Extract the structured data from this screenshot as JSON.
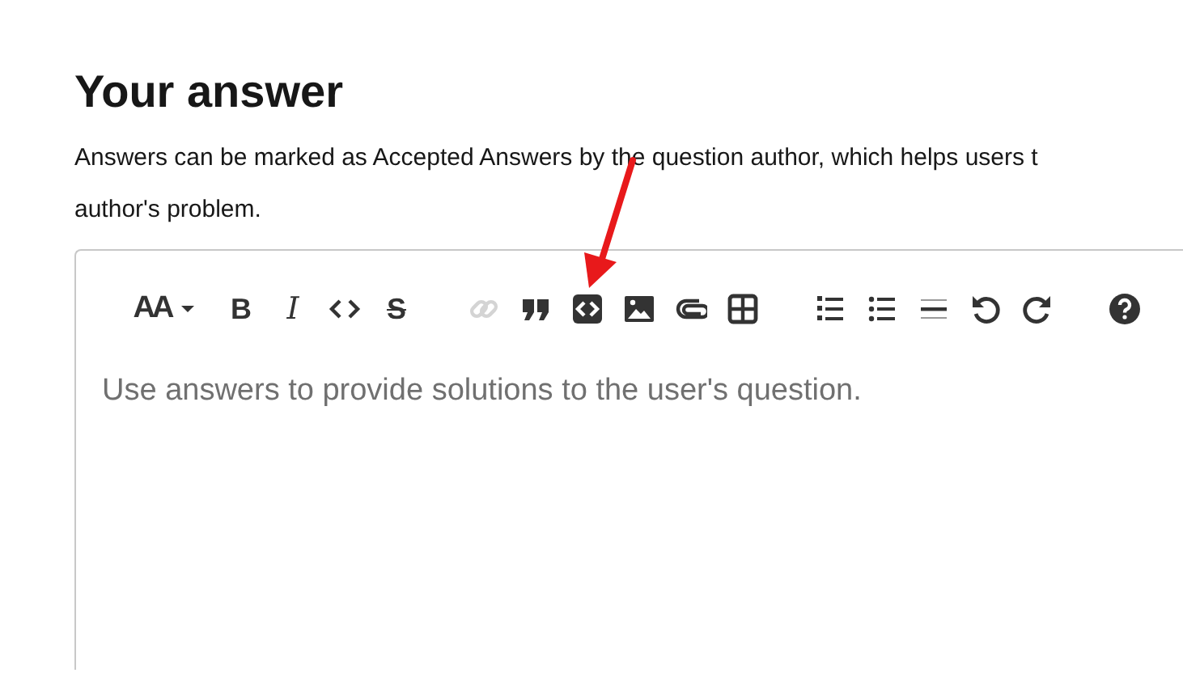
{
  "heading": "Your answer",
  "description_lines": [
    "Answers can be marked as Accepted Answers by the question author, which helps users t",
    "author's problem."
  ],
  "toolbar_groups": [
    {
      "buttons": [
        {
          "kind": "font-size",
          "label": "AA",
          "disabled": false
        },
        {
          "kind": "bold",
          "label": "B",
          "disabled": false
        },
        {
          "kind": "italic",
          "label": "I",
          "disabled": false
        },
        {
          "kind": "code",
          "disabled": false
        },
        {
          "kind": "strike",
          "label": "S",
          "disabled": false
        }
      ]
    },
    {
      "buttons": [
        {
          "kind": "link",
          "disabled": true
        },
        {
          "kind": "quote",
          "disabled": false
        },
        {
          "kind": "code-block",
          "disabled": false
        },
        {
          "kind": "image",
          "disabled": false
        },
        {
          "kind": "attach",
          "disabled": false
        },
        {
          "kind": "table",
          "disabled": false
        }
      ]
    },
    {
      "buttons": [
        {
          "kind": "ordered-list",
          "disabled": false
        },
        {
          "kind": "bullet-list",
          "disabled": false
        },
        {
          "kind": "rule",
          "disabled": false
        },
        {
          "kind": "undo",
          "disabled": false
        },
        {
          "kind": "redo",
          "disabled": false
        }
      ]
    },
    {
      "buttons": [
        {
          "kind": "help",
          "disabled": false
        }
      ]
    }
  ],
  "editor": {
    "placeholder": "Use answers to provide solutions to the user's question."
  }
}
